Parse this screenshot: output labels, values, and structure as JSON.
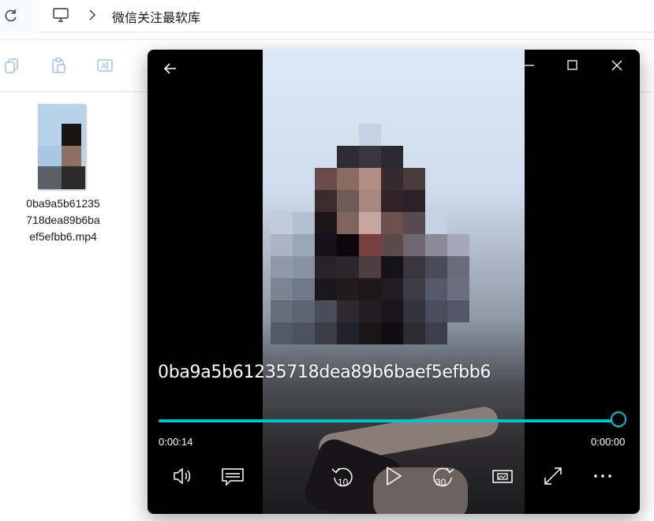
{
  "explorer": {
    "breadcrumb": "微信关注最软库",
    "file": {
      "name_lines": [
        "0ba9a5b61235",
        "718dea89b6ba",
        "ef5efbb6.mp4"
      ]
    },
    "toolbar_icons": [
      "copy-icon",
      "paste-icon",
      "rename-icon"
    ]
  },
  "player": {
    "title": "0ba9a5b61235718dea89b6baef5efbb6",
    "elapsed": "0:00:14",
    "remaining": "0:00:00",
    "progress_fraction": 1.0,
    "accent_color": "#00c4cc",
    "skip_back_seconds": "10",
    "skip_forward_seconds": "30",
    "controls": [
      "volume-icon",
      "subtitles-icon",
      "skip-back-icon",
      "play-icon",
      "skip-forward-icon",
      "miniplayer-icon",
      "fullscreen-icon",
      "more-icon"
    ]
  }
}
